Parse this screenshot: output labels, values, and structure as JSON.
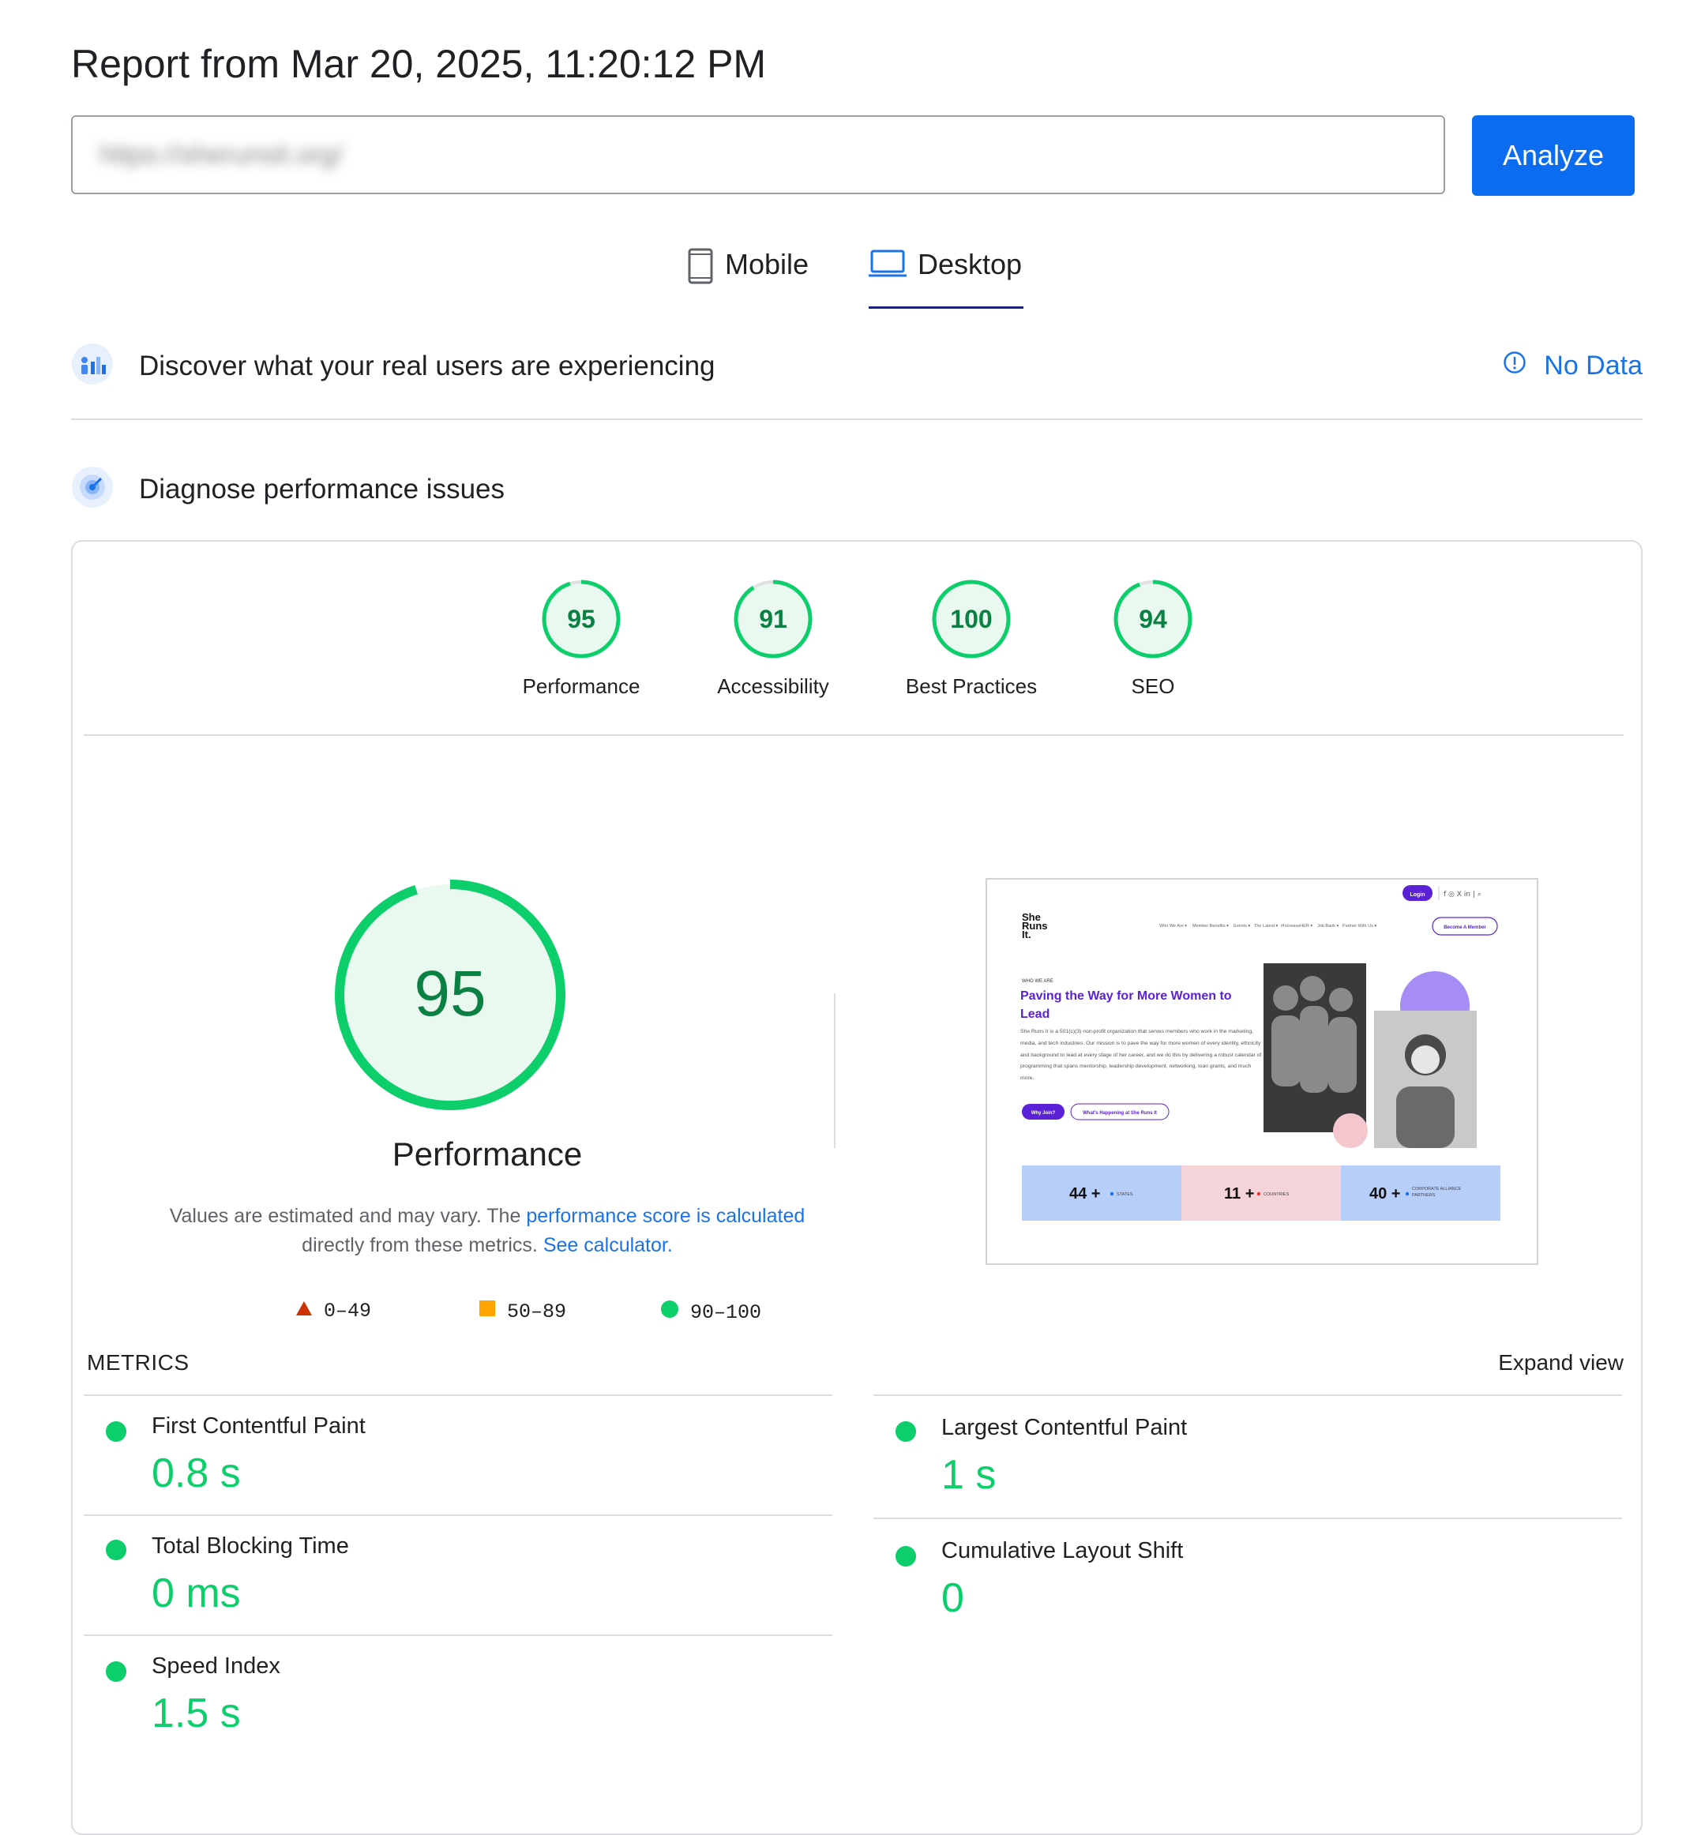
{
  "report": {
    "title": "Report from Mar 20, 2025, 11:20:12 PM"
  },
  "url_input": {
    "value": "https://sherunsit.org/"
  },
  "analyze_button": {
    "label": "Analyze"
  },
  "device_tabs": {
    "mobile_label": "Mobile",
    "desktop_label": "Desktop",
    "selected": "Desktop"
  },
  "field_data": {
    "title": "Discover what your real users are experiencing",
    "status": "No Data"
  },
  "diagnose": {
    "title": "Diagnose performance issues"
  },
  "categories": [
    {
      "label": "Performance",
      "score": "95",
      "fraction": 0.95
    },
    {
      "label": "Accessibility",
      "score": "91",
      "fraction": 0.91
    },
    {
      "label": "Best Practices",
      "score": "100",
      "fraction": 1.0
    },
    {
      "label": "SEO",
      "score": "94",
      "fraction": 0.94
    }
  ],
  "performance": {
    "score": "95",
    "fraction": 0.95,
    "title": "Performance",
    "desc_prefix": "Values are estimated and may vary. The ",
    "desc_link1": "performance score is calculated",
    "desc_middle": "directly from these metrics. ",
    "desc_link2": "See calculator."
  },
  "legend": {
    "fail": "0–49",
    "average": "50–89",
    "pass": "90–100"
  },
  "colors": {
    "pass": "#0cce6b",
    "average": "#ffa400",
    "fail": "#cc3300",
    "link": "#1a73e8",
    "analyze": "#0b6cf0"
  },
  "metrics": {
    "section_label": "METRICS",
    "expand_label": "Expand view",
    "fcp": {
      "name": "First Contentful Paint",
      "value": "0.8 s"
    },
    "lcp": {
      "name": "Largest Contentful Paint",
      "value": "1 s"
    },
    "tbt": {
      "name": "Total Blocking Time",
      "value": "0 ms"
    },
    "cls": {
      "name": "Cumulative Layout Shift",
      "value": "0"
    },
    "si": {
      "name": "Speed Index",
      "value": "1.5 s"
    }
  },
  "thumbnail": {
    "logo": [
      "She",
      "Runs",
      "It."
    ],
    "login_label": "Login",
    "nav_items": [
      "Who We Are ▾",
      "Member Benefits ▾",
      "Events ▾",
      "The Latest ▾",
      "#IncreaseHER ▾",
      "Job Bank ▾",
      "Partner With Us ▾"
    ],
    "become_member_label": "Become A Member",
    "eyebrow": "WHO WE ARE",
    "headline": "Paving the Way for More Women to Lead",
    "body": "She Runs It is a 501(c)(3) non-profit organization that serves members who work in the marketing, media, and tech industries. Our mission is to pave the way for more women of every identity, ethnicity and background to lead at every stage of her career, and we do this by delivering a robust calendar of programming that spans mentorship, leadership development, networking, loan grants, and much more.",
    "why_join_label": "Why Join?",
    "happening_label": "What's Happening at She Runs It",
    "stats": [
      {
        "value": "44 +",
        "label": "STATES"
      },
      {
        "value": "11 +",
        "label": "COUNTRIES"
      },
      {
        "value": "40 +",
        "label": "CORPORATE ALLIANCE PARTNERS"
      }
    ]
  }
}
